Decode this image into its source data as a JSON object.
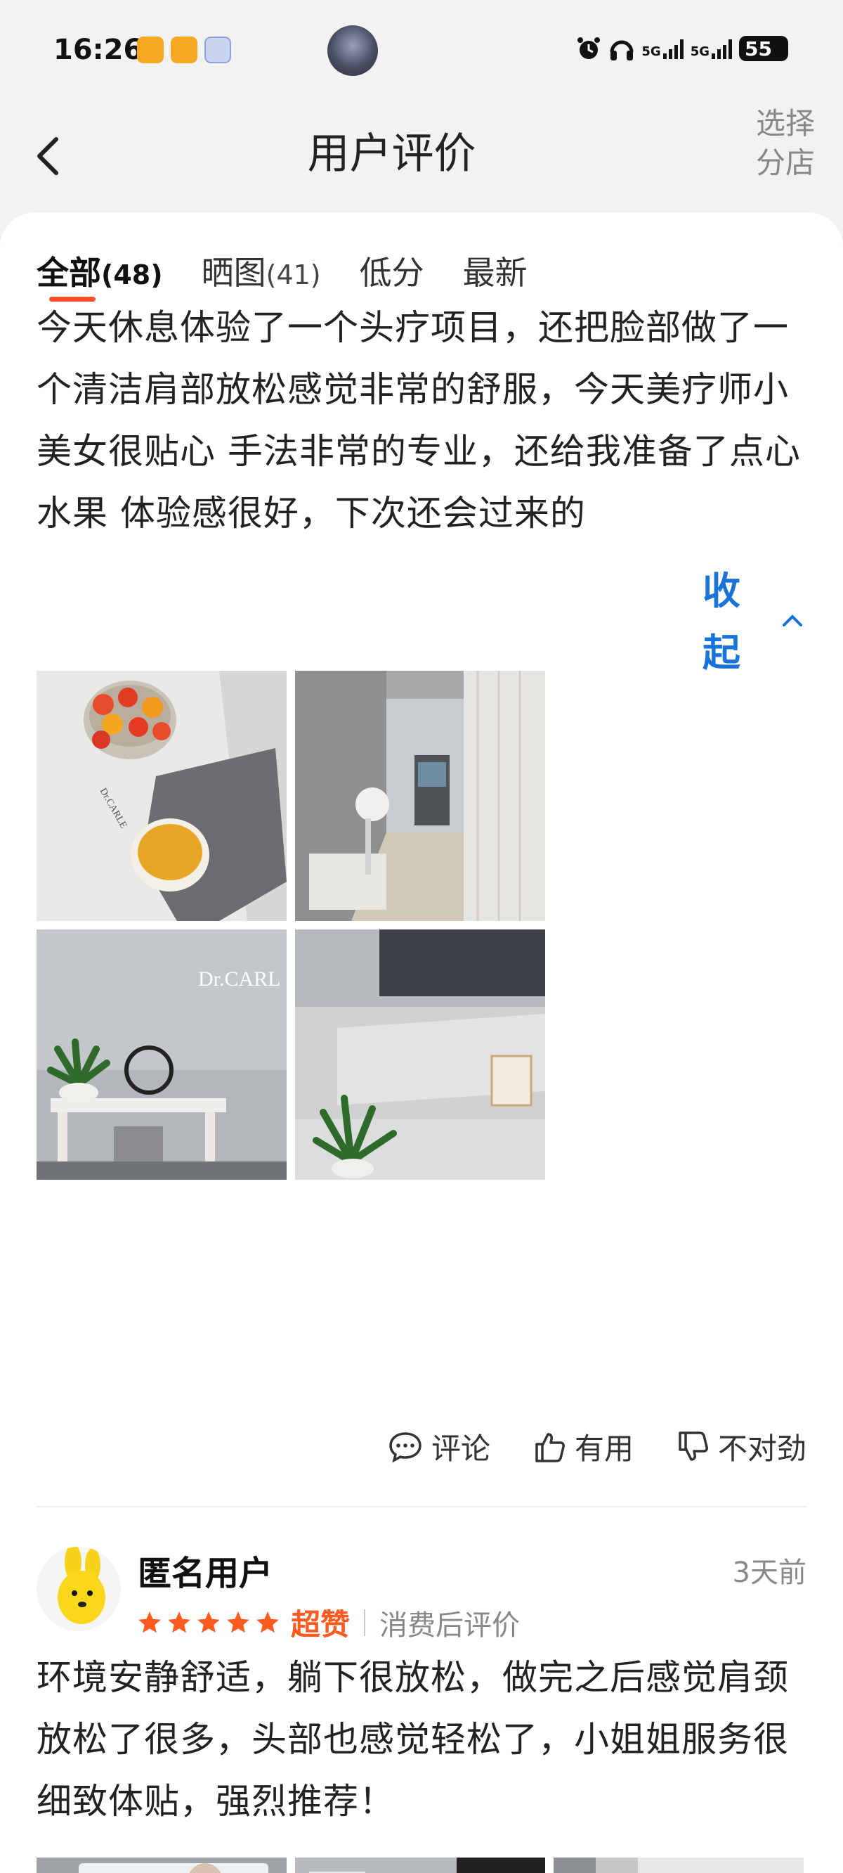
{
  "status_bar": {
    "time": "16:26",
    "signal_1": "5G",
    "signal_2": "5G",
    "battery": "55"
  },
  "header": {
    "title": "用户评价",
    "branch_button": "选择分店"
  },
  "tabs": [
    {
      "label": "全部",
      "count": "(48)",
      "active": true
    },
    {
      "label": "晒图",
      "count": "(41)",
      "active": false
    },
    {
      "label": "低分",
      "count": "",
      "active": false
    },
    {
      "label": "最新",
      "count": "",
      "active": false
    }
  ],
  "review1": {
    "text": "今天休息体验了一个头疗项目，还把脸部做了一个清洁肩部放松感觉非常的舒服，今天美疗师小美女很贴心 手法非常的专业，￼还给我准备了点心水果 体验感很好，下次还会过来的￼",
    "collapse_label": "收起",
    "photos": [
      "fruit-bowl-and-tea",
      "treatment-room",
      "reception-desk-with-plant",
      "wall-display-with-plant"
    ],
    "actions": {
      "comment": "评论",
      "useful": "有用",
      "not_right": "不对劲"
    }
  },
  "review2": {
    "username": "匿名用户",
    "time_ago": "3天前",
    "stars": 5,
    "rating_word": "超赞",
    "rating_note": "消费后评价",
    "text": "环境安静舒适，躺下很放松，做完之后感觉肩颈放松了很多，头部也感觉轻松了，小姐姐服务很细致体贴，强烈推荐！",
    "photos": [
      "poster-display-shelf",
      "store-interior-mirror",
      "ceiling-curtains"
    ]
  },
  "colors": {
    "accent_blue": "#1a73d9",
    "tab_underline": "#ff4e2a",
    "rating_orange": "#ff5a1f"
  }
}
